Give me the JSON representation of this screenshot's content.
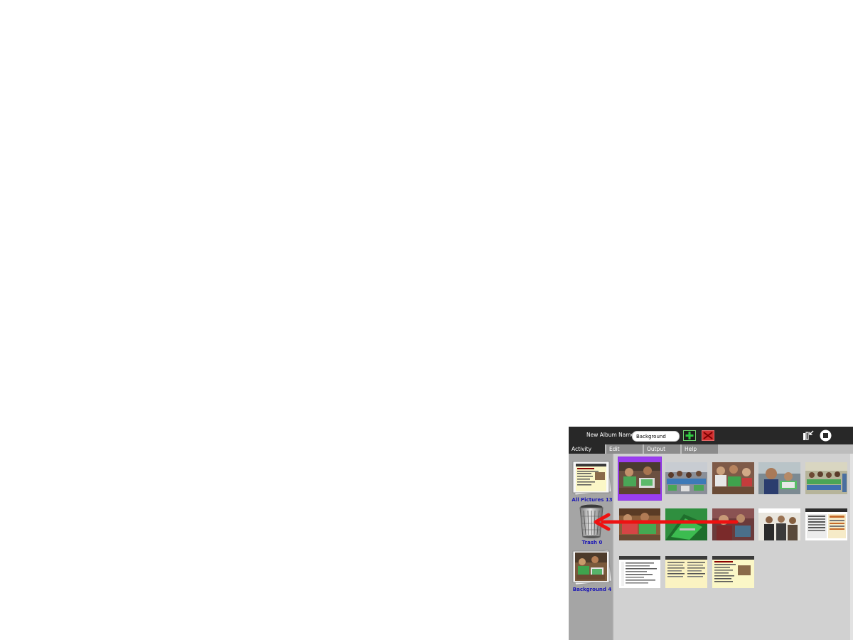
{
  "toolbar": {
    "album_name_label": "New Album Name:",
    "album_name_value": "Background",
    "add_icon": "green-plus-icon",
    "remove_icon": "red-x-icon",
    "fullscreen_icon": "fullscreen-icon",
    "stop_icon": "stop-icon"
  },
  "tabs": [
    {
      "label": "Activity",
      "active": true
    },
    {
      "label": "Edit",
      "active": false
    },
    {
      "label": "Output",
      "active": false
    },
    {
      "label": "Help",
      "active": false
    }
  ],
  "albums": [
    {
      "name": "All Pictures 13",
      "icon": "album-stack-icon"
    },
    {
      "name": "Trash 0",
      "icon": "trash-icon"
    },
    {
      "name": "Background 4",
      "icon": "album-stack-icon"
    }
  ],
  "colors": {
    "toolbar_bg": "#282828",
    "sidebar_bg": "#a5a5a5",
    "grid_bg": "#d1d1d1",
    "album_label": "#1b16b5",
    "selection": "#9a3ef0",
    "drag_arrow": "#ee1111"
  }
}
